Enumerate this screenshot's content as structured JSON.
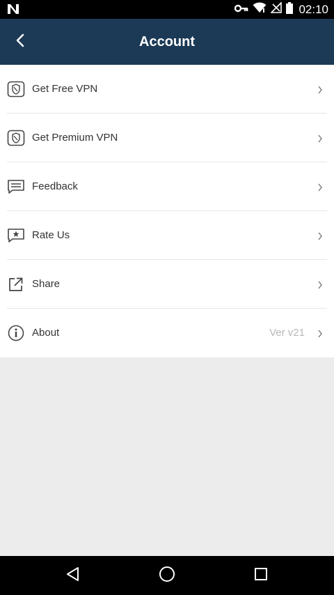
{
  "status_bar": {
    "time": "02:10",
    "icons": [
      "notification-n-icon",
      "key-icon",
      "wifi-icon",
      "no-signal-icon",
      "battery-icon"
    ]
  },
  "app_bar": {
    "title": "Account",
    "back_icon": "back-arrow-icon",
    "color": "#1c3a56"
  },
  "menu": {
    "items": [
      {
        "label": "Get Free VPN",
        "icon": "vpn-shield-icon",
        "value": ""
      },
      {
        "label": "Get Premium VPN",
        "icon": "vpn-shield-icon",
        "value": ""
      },
      {
        "label": "Feedback",
        "icon": "feedback-icon",
        "value": ""
      },
      {
        "label": "Rate Us",
        "icon": "rate-star-icon",
        "value": ""
      },
      {
        "label": "Share",
        "icon": "share-icon",
        "value": ""
      },
      {
        "label": "About",
        "icon": "info-icon",
        "value": "Ver v21"
      }
    ]
  },
  "nav_bar": {
    "icons": [
      "back-triangle-icon",
      "home-circle-icon",
      "recents-square-icon"
    ]
  }
}
